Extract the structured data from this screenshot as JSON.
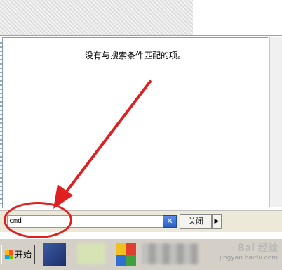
{
  "results": {
    "message": "没有与搜索条件匹配的项。"
  },
  "search": {
    "query": "cmd",
    "clear_glyph": "✕",
    "button_label": "关闭",
    "arrow_glyph": "▶"
  },
  "taskbar": {
    "start_label": "开始"
  },
  "watermark": {
    "line1": "Bai 经验",
    "line2": "jingyan.baidu.com"
  },
  "colors": {
    "annotation": "#e02020",
    "input_border": "#7f9db9",
    "taskbar": "#d4d0c8"
  },
  "icons": [
    "windows-logo-icon",
    "clear-search-icon",
    "dropdown-arrow-icon"
  ]
}
